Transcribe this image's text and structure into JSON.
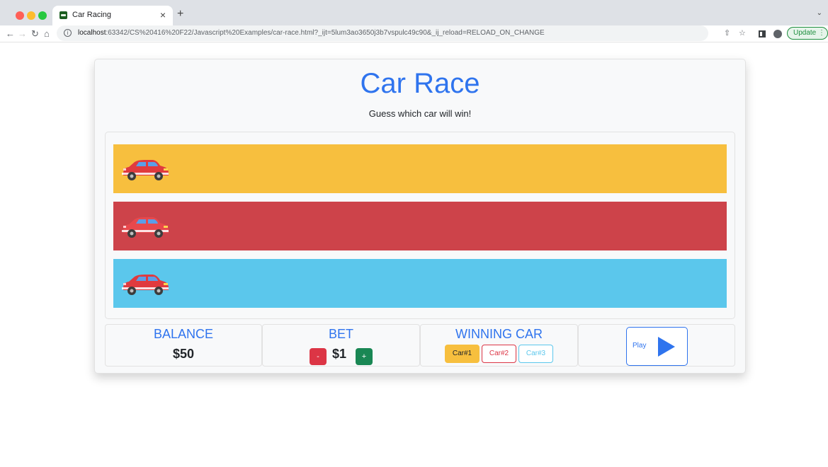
{
  "browser": {
    "tab_title": "Car Racing",
    "tab_close": "×",
    "new_tab": "+",
    "url_host": "localhost",
    "url_path": ":63342/CS%20416%20F22/Javascript%20Examples/car-race.html?_ijt=5lum3ao3650j3b7vspulc49c90&_ij_reload=RELOAD_ON_CHANGE",
    "update_label": "Update"
  },
  "page": {
    "title": "Car Race",
    "subtitle": "Guess which car will win!"
  },
  "lanes": [
    {
      "color": "#f7bf3e"
    },
    {
      "color": "#cd434a"
    },
    {
      "color": "#5bc7ec"
    }
  ],
  "balance": {
    "label": "BALANCE",
    "value": "$50"
  },
  "bet": {
    "label": "BET",
    "minus_label": "-",
    "value": "$1",
    "plus_label": "+"
  },
  "winning_car": {
    "label": "WINNING CAR",
    "options": [
      "Car#1",
      "Car#2",
      "Car#3"
    ],
    "selected": "Car#1"
  },
  "play": {
    "label": "Play"
  },
  "colors": {
    "accent": "#2f74ee",
    "yellow": "#f7bf3e",
    "red": "#dc3545",
    "cyan": "#5bc7ec",
    "green": "#198754"
  },
  "icons": {
    "car": "red-car-icon",
    "play": "play-triangle-icon"
  }
}
